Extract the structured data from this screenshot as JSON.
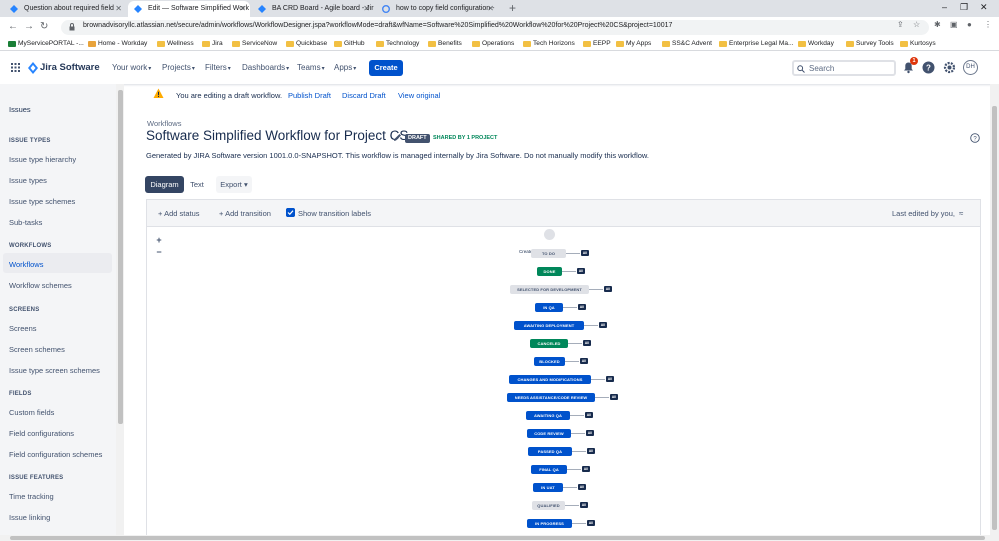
{
  "browser": {
    "tabs": [
      {
        "title": "Question about required field",
        "active": false
      },
      {
        "title": "Edit — Software Simplified Work",
        "active": true
      },
      {
        "title": "BA CRD Board - Agile board - Jir",
        "active": false
      },
      {
        "title": "how to copy field configuration -",
        "active": false
      }
    ],
    "url": "brownadvisoryllc.atlassian.net/secure/admin/workflows/WorkflowDesigner.jspa?workflowMode=draft&wfName=Software%20Simplified%20Workflow%20for%20Project%20CS&project=10017",
    "bookmarks": [
      "MyServicePORTAL -...",
      "Home - Workday",
      "Wellness",
      "Jira",
      "ServiceNow",
      "Quickbase",
      "GitHub",
      "Technology",
      "Benefits",
      "Operations",
      "Tech Horizons",
      "EEPP",
      "My Apps",
      "SS&C Advent",
      "Enterprise Legal Ma...",
      "Workday",
      "Survey Tools",
      "Kurtosys"
    ]
  },
  "jira": {
    "product": "Jira Software",
    "menus": [
      "Your work",
      "Projects",
      "Filters",
      "Dashboards",
      "Teams",
      "Apps"
    ],
    "create_label": "Create",
    "search_placeholder": "Search",
    "notification_count": "1",
    "avatar_initials": "DH"
  },
  "sidebar": {
    "top_item": "Issues",
    "sections": [
      {
        "heading": "ISSUE TYPES",
        "items": [
          "Issue type hierarchy",
          "Issue types",
          "Issue type schemes",
          "Sub-tasks"
        ]
      },
      {
        "heading": "WORKFLOWS",
        "items": [
          "Workflows",
          "Workflow schemes"
        ]
      },
      {
        "heading": "SCREENS",
        "items": [
          "Screens",
          "Screen schemes",
          "Issue type screen schemes"
        ]
      },
      {
        "heading": "FIELDS",
        "items": [
          "Custom fields",
          "Field configurations",
          "Field configuration schemes"
        ]
      },
      {
        "heading": "ISSUE FEATURES",
        "items": [
          "Time tracking",
          "Issue linking"
        ]
      }
    ],
    "selected": "Workflows"
  },
  "banner": {
    "message": "You are editing a draft workflow.",
    "publish": "Publish Draft",
    "discard": "Discard Draft",
    "view_original": "View original"
  },
  "page": {
    "breadcrumb": "Workflows",
    "title": "Software Simplified Workflow for Project CS",
    "draft_lozenge": "DRAFT",
    "shared": "SHARED BY 1 PROJECT",
    "description": "Generated by JIRA Software version 1001.0.0-SNAPSHOT. This workflow is managed internally by Jira Software. Do not manually modify this workflow.",
    "view_tabs": [
      "Diagram",
      "Text"
    ],
    "export_label": "Export"
  },
  "designer": {
    "add_status": "Add status",
    "add_transition": "Add transition",
    "show_labels": "Show transition labels",
    "show_labels_checked": true,
    "last_edited": "Last edited by you,",
    "create_label": "Create",
    "all_label": "All",
    "statuses": [
      {
        "name": "TO DO",
        "category": "todo"
      },
      {
        "name": "DONE",
        "category": "done"
      },
      {
        "name": "SELECTED FOR DEVELOPMENT",
        "category": "todo"
      },
      {
        "name": "IN QA",
        "category": "prog"
      },
      {
        "name": "AWAITING DEPLOYMENT",
        "category": "prog"
      },
      {
        "name": "CANCELED",
        "category": "done"
      },
      {
        "name": "BLOCKED",
        "category": "prog"
      },
      {
        "name": "CHANGES AND MODIFICATIONS",
        "category": "prog"
      },
      {
        "name": "NEEDS ASSISTANCE/CODE REVIEW",
        "category": "prog"
      },
      {
        "name": "AWAITING QA",
        "category": "prog"
      },
      {
        "name": "CODE REVIEW",
        "category": "prog"
      },
      {
        "name": "PASSED QA",
        "category": "prog"
      },
      {
        "name": "FINAL QA",
        "category": "prog"
      },
      {
        "name": "IN UAT",
        "category": "prog"
      },
      {
        "name": "QUALIFIED",
        "category": "todo"
      },
      {
        "name": "IN PROGRESS",
        "category": "prog"
      }
    ]
  }
}
